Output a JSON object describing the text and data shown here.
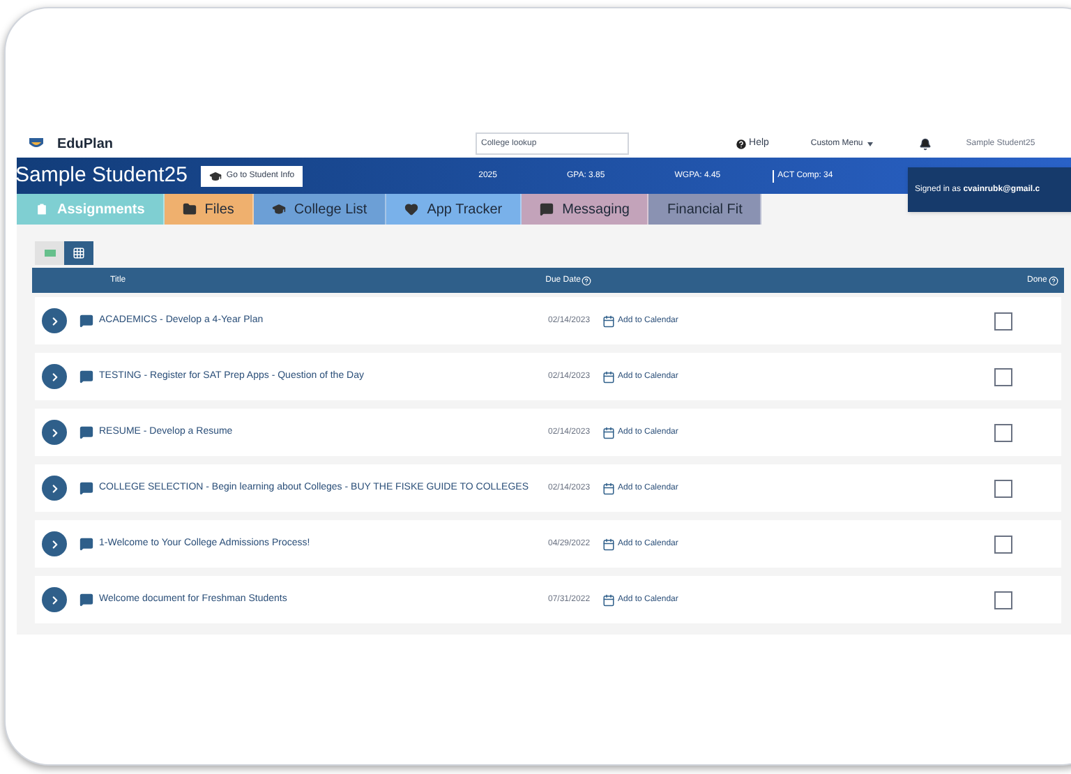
{
  "app": {
    "name": "EduPlan"
  },
  "search": {
    "placeholder": "College lookup"
  },
  "nav": {
    "help": "Help",
    "menu": "Custom Menu",
    "user": "Sample Student25"
  },
  "header": {
    "student": "Sample Student25",
    "button": "Go to Student Info",
    "stats": [
      "2025",
      "GPA: 3.85",
      "WGPA: 4.45",
      "ACT Comp: 34"
    ]
  },
  "popup": {
    "text": "Signed in as **cvainrubk@gmail.c**"
  },
  "tabs": [
    {
      "label": "Assignments",
      "kind": "clipboard",
      "color": "#7fcfd2",
      "selected": true
    },
    {
      "label": "Files",
      "kind": "folder",
      "color": "#efb06e",
      "selected": false
    },
    {
      "label": "College List",
      "kind": "cap",
      "color": "#6c9fd6",
      "selected": false
    },
    {
      "label": "App Tracker",
      "kind": "heart",
      "color": "#79b1ea",
      "selected": false
    },
    {
      "label": "Messaging",
      "kind": "chat",
      "color": "#c3a3ba",
      "selected": false
    },
    {
      "label": "Financial Fit",
      "kind": "plain",
      "color": "#8a92b2",
      "selected": false
    }
  ],
  "view_toggle": [
    {
      "kind": "list",
      "selected": false
    },
    {
      "kind": "grid",
      "selected": true
    }
  ],
  "table": {
    "columns": [
      "Title",
      "Due Date",
      "Done"
    ],
    "rows": [
      {
        "title": "ACADEMICS - Develop a 4-Year Plan",
        "due": "02/14/2023",
        "calendar": "Add to Calendar",
        "done": false
      },
      {
        "title": "TESTING - Register for SAT Prep Apps - Question of the Day",
        "due": "02/14/2023",
        "calendar": "Add to Calendar",
        "done": false
      },
      {
        "title": "RESUME - Develop a Resume",
        "due": "02/14/2023",
        "calendar": "Add to Calendar",
        "done": false
      },
      {
        "title": "COLLEGE SELECTION - Begin learning about Colleges - BUY THE FISKE GUIDE TO COLLEGES",
        "due": "02/14/2023",
        "calendar": "Add to Calendar",
        "done": false
      },
      {
        "title": "1-Welcome to Your College Admissions Process!",
        "due": "04/29/2022",
        "calendar": "Add to Calendar",
        "done": false
      },
      {
        "title": "Welcome document for Freshman Students",
        "due": "07/31/2022",
        "calendar": "Add to Calendar",
        "done": false
      }
    ]
  }
}
